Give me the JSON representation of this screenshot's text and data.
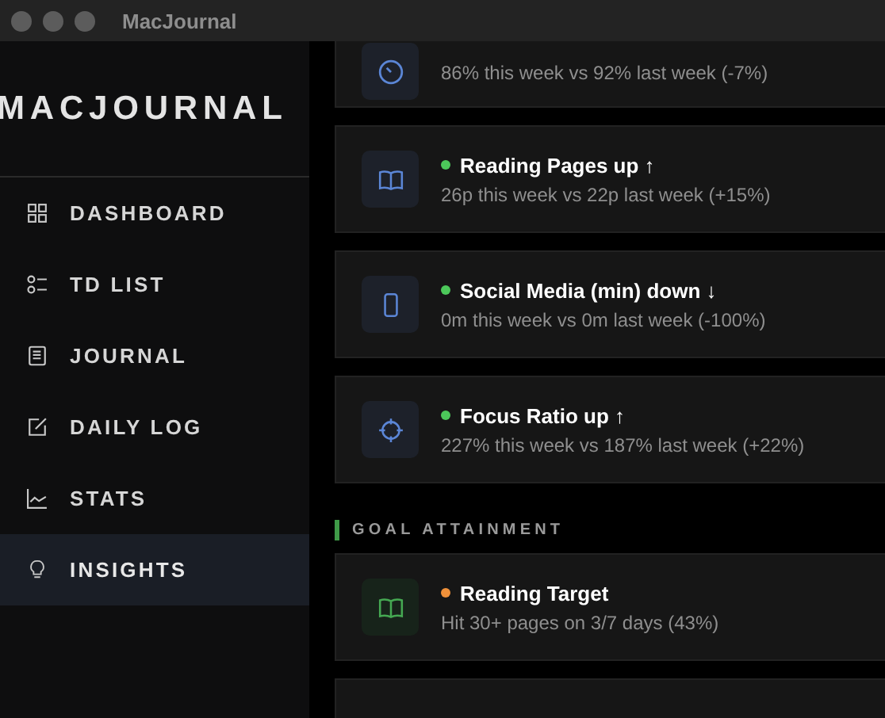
{
  "window": {
    "title": "MacJournal"
  },
  "sidebar": {
    "logo": "MACJOURNAL",
    "items": [
      {
        "label": "DASHBOARD",
        "kind": "grid",
        "selected": false
      },
      {
        "label": "TD LIST",
        "kind": "list",
        "selected": false
      },
      {
        "label": "JOURNAL",
        "kind": "notebook",
        "selected": false
      },
      {
        "label": "DAILY LOG",
        "kind": "edit",
        "selected": false
      },
      {
        "label": "STATS",
        "kind": "chart",
        "selected": false
      },
      {
        "label": "INSIGHTS",
        "kind": "bulb",
        "selected": true
      }
    ]
  },
  "trends": [
    {
      "kind": "gauge",
      "description": "86% this week vs 92% last week (-7%)"
    },
    {
      "kind": "book",
      "color": "#4cc85a",
      "title": "Reading Pages up ↑",
      "description": "26p this week vs 22p last week (+15%)"
    },
    {
      "kind": "phone",
      "color": "#4cc85a",
      "title": "Social Media (min) down ↓",
      "description": "0m this week vs 0m last week (-100%)"
    },
    {
      "kind": "target",
      "color": "#4cc85a",
      "title": "Focus Ratio up ↑",
      "description": "227% this week vs 187% last week (+22%)"
    }
  ],
  "goal_section": {
    "heading": "GOAL ATTAINMENT",
    "goals": [
      {
        "kind": "book",
        "color": "#f0913a",
        "title": "Reading Target",
        "description": "Hit 30+ pages on 3/7 days (43%)"
      },
      {
        "kind": "empty"
      }
    ]
  }
}
